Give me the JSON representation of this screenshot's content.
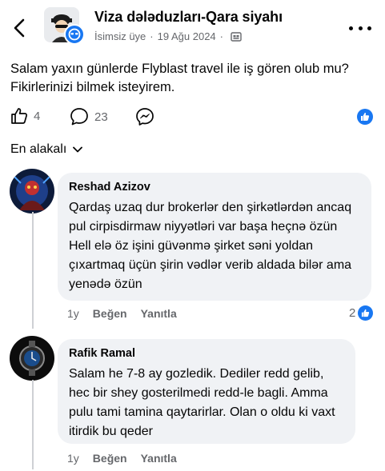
{
  "header": {
    "group_title": "Viza dələduzları-Qara siyahı",
    "author": "İsimsiz üye",
    "date": "19 Ağu 2024",
    "separator": "·",
    "back_icon": "chevron-left-icon",
    "more_icon": "more-dots-icon"
  },
  "post": {
    "text": "Salam yaxın günlerde Flyblast travel ile iş gören olub mu? Fikirlerinizi bilmek isteyirem.",
    "like_count": "4",
    "comment_count": "23"
  },
  "sort": {
    "label": "En alakalı"
  },
  "comments": [
    {
      "author": "Reshad Azizov",
      "text": "Qardaş uzaq dur brokerlər den şirkətlərdən ancaq pul cirpisdirmaw niyyətləri var başa heçnə özün Hell elə öz işini güvənmə şirket səni yoldan çıxartmaq üçün şirin vədlər verib aldada bilər ama yenədə özün",
      "time": "1y",
      "like_label": "Beğen",
      "reply_label": "Yanıtla",
      "reaction_count": "2"
    },
    {
      "author": "Rafik Ramal",
      "text": "Salam he 7-8 ay gozledik. Dediler redd gelib, hec bir shey gosterilmedi redd-le bagli. Amma pulu tami tamina qaytarirlar. Olan o oldu ki vaxt itirdik bu qeder",
      "time": "1y",
      "like_label": "Beğen",
      "reply_label": "Yanıtla"
    }
  ],
  "colors": {
    "accent": "#1877f2",
    "bubble": "#f0f2f5",
    "secondary_text": "#65676b"
  }
}
